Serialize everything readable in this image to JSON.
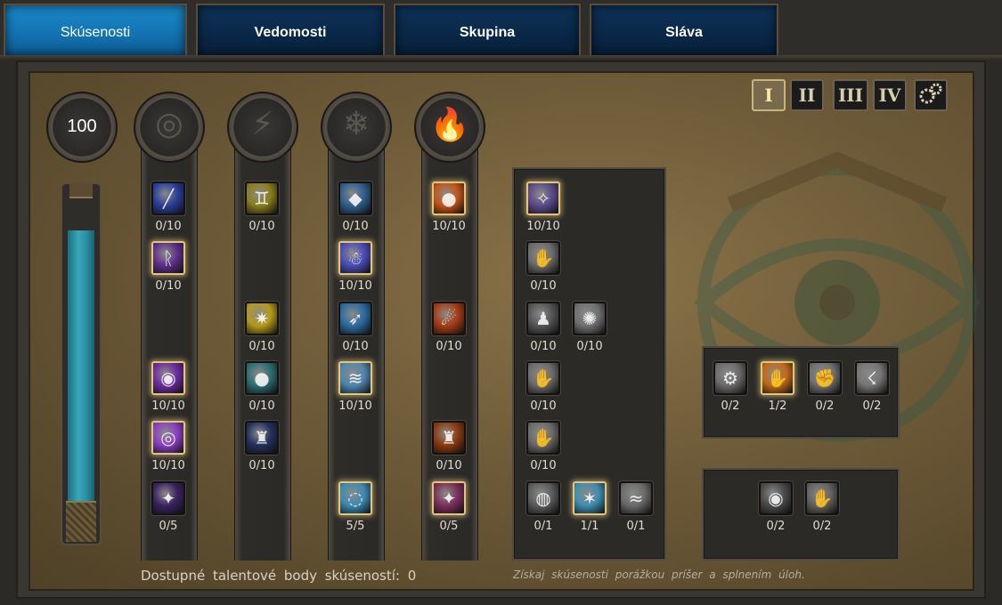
{
  "tabs": [
    {
      "label": "Skúsenosti",
      "active": true
    },
    {
      "label": "Vedomosti",
      "active": false
    },
    {
      "label": "Skupina",
      "active": false
    },
    {
      "label": "Sláva",
      "active": false
    }
  ],
  "pages": [
    "I",
    "II",
    "III",
    "IV"
  ],
  "active_page": "I",
  "columns": [
    {
      "header_value": "100",
      "header_icon": "progress-meter",
      "bar_fill_fraction": 1.0
    },
    {
      "header_icon": "arcane-rune-icon",
      "skills": [
        {
          "icon": "arcane-bolt-icon",
          "count": "0/10",
          "color": "#2a3f9a"
        },
        {
          "icon": "arcane-runes-icon",
          "count": "0/10",
          "color": "#5d2f8a",
          "glow": true
        },
        null,
        {
          "icon": "void-vortex-icon",
          "count": "10/10",
          "color": "#6b2b9e",
          "glow": true
        },
        {
          "icon": "purple-eye-icon",
          "count": "10/10",
          "color": "#8a3fc2",
          "glow": true
        },
        {
          "icon": "violet-strike-icon",
          "count": "0/5",
          "color": "#3a2260"
        }
      ]
    },
    {
      "header_icon": "lightning-icon",
      "skills": [
        {
          "icon": "twin-spirits-icon",
          "count": "0/10",
          "color": "#8a7d1c"
        },
        null,
        {
          "icon": "lightning-burst-icon",
          "count": "0/10",
          "color": "#b59a1a"
        },
        {
          "icon": "storm-orb-icon",
          "count": "0/10",
          "color": "#2f6e72"
        },
        {
          "icon": "thunder-armor-icon",
          "count": "0/10",
          "color": "#25305e"
        },
        null
      ]
    },
    {
      "header_icon": "snowflake-icon",
      "skills": [
        {
          "icon": "ice-shard-icon",
          "count": "0/10",
          "color": "#2f5f8e"
        },
        {
          "icon": "frost-spirit-icon",
          "count": "10/10",
          "color": "#4a4cb8",
          "glow": true
        },
        {
          "icon": "frost-bolt-icon",
          "count": "0/10",
          "color": "#2c6aa0"
        },
        {
          "icon": "blizzard-icon",
          "count": "10/10",
          "color": "#4f86b0",
          "glow": true
        },
        null,
        {
          "icon": "ice-ring-icon",
          "count": "5/5",
          "color": "#3b8bb0",
          "glow": true
        }
      ]
    },
    {
      "header_icon": "flame-icon",
      "skills": [
        {
          "icon": "fireball-icon",
          "count": "10/10",
          "color": "#c2541a",
          "glow": true
        },
        null,
        {
          "icon": "meteor-icon",
          "count": "0/10",
          "color": "#a63c14"
        },
        null,
        {
          "icon": "fire-armor-icon",
          "count": "0/10",
          "color": "#8a3a10"
        },
        {
          "icon": "fire-strike-icon",
          "count": "0/5",
          "color": "#7a2f5a",
          "glow": true
        }
      ]
    }
  ],
  "right_panel": {
    "rows": [
      [
        {
          "icon": "divine-glow-icon",
          "count": "10/10",
          "color": "#5a4a8a",
          "glow": true
        }
      ],
      [
        {
          "icon": "hand-burst-icon",
          "count": "0/10",
          "color": "#6b6b6b"
        }
      ],
      [
        {
          "icon": "shadow-figure-icon",
          "count": "0/10",
          "color": "#555555"
        },
        {
          "icon": "spirit-burst-icon",
          "count": "0/10",
          "color": "#707070"
        }
      ],
      [
        {
          "icon": "hand-burst-icon",
          "count": "0/10",
          "color": "#6b6b6b"
        }
      ],
      [
        {
          "icon": "hand-burst-icon",
          "count": "0/10",
          "color": "#6b6b6b"
        }
      ],
      [
        {
          "icon": "orb-gargoyle-icon",
          "count": "0/1",
          "color": "#5c5c5c"
        },
        {
          "icon": "spark-figure-icon",
          "count": "1/1",
          "color": "#3d8eb0",
          "glow": true
        },
        {
          "icon": "wind-slash-icon",
          "count": "0/1",
          "color": "#6a6a6a"
        }
      ]
    ]
  },
  "box1": [
    {
      "icon": "gear-hand-icon",
      "count": "0/2",
      "color": "#6b6b6b"
    },
    {
      "icon": "fire-hand-icon",
      "count": "1/2",
      "color": "#c06a1a",
      "glow": true
    },
    {
      "icon": "armored-hand-icon",
      "count": "0/2",
      "color": "#707070"
    },
    {
      "icon": "lightning-hand-icon",
      "count": "0/2",
      "color": "#757575"
    }
  ],
  "box2": [
    {
      "icon": "dark-orb-icon",
      "count": "0/2",
      "color": "#4a4a4a"
    },
    {
      "icon": "claw-hand-icon",
      "count": "0/2",
      "color": "#626262"
    }
  ],
  "footer": {
    "left": "Dostupné talentové body skúseností: 0",
    "right": "Získaj skúsenosti porážkou príšer a splnením úloh."
  }
}
